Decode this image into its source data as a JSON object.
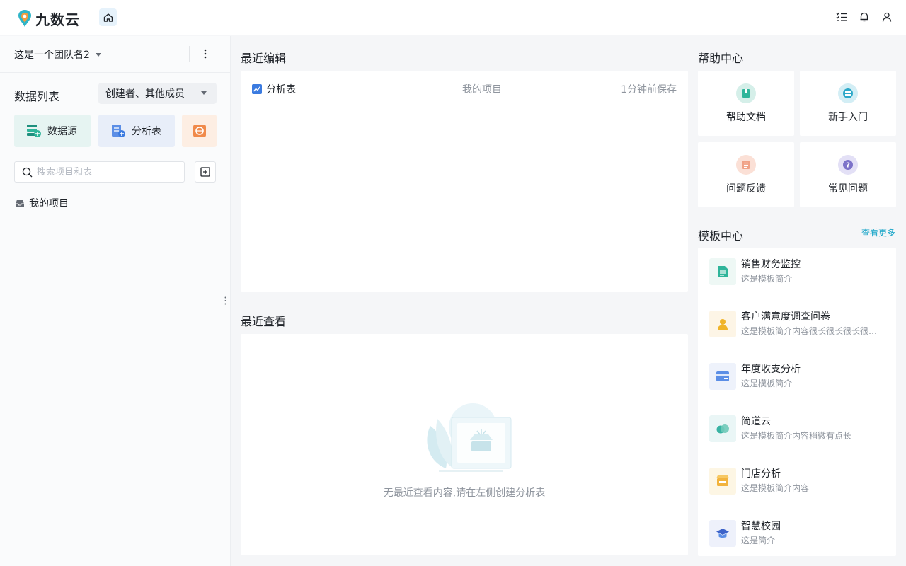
{
  "app": {
    "brand": "九数云"
  },
  "sidebar": {
    "team_name": "这是一个团队名2",
    "list_title": "数据列表",
    "filter": "创建者、其他成员",
    "tiles": {
      "datasource": "数据源",
      "analysis": "分析表"
    },
    "search_placeholder": "搜索项目和表",
    "my_projects": "我的项目"
  },
  "recent_edit": {
    "title": "最近编辑",
    "rows": [
      {
        "name": "分析表",
        "project": "我的项目",
        "time": "1分钟前保存"
      }
    ]
  },
  "recent_view": {
    "title": "最近查看",
    "empty_text": "无最近查看内容,请在左侧创建分析表"
  },
  "help_center": {
    "title": "帮助中心",
    "items": [
      "帮助文档",
      "新手入门",
      "问题反馈",
      "常见问题"
    ]
  },
  "templates": {
    "title": "模板中心",
    "more": "查看更多",
    "items": [
      {
        "name": "销售财务监控",
        "desc": "这是模板简介"
      },
      {
        "name": "客户满意度调查问卷",
        "desc": "这是模板简介内容很长很长很长很长很长很长"
      },
      {
        "name": "年度收支分析",
        "desc": "这是模板简介"
      },
      {
        "name": "简道云",
        "desc": "这是模板简介内容稍微有点长"
      },
      {
        "name": "门店分析",
        "desc": "这是模板简介内容"
      },
      {
        "name": "智慧校园",
        "desc": "这是简介"
      }
    ]
  },
  "colors": {
    "accent": "#16a4c7",
    "teal": "#2fb59a",
    "blue": "#3b7be0"
  }
}
